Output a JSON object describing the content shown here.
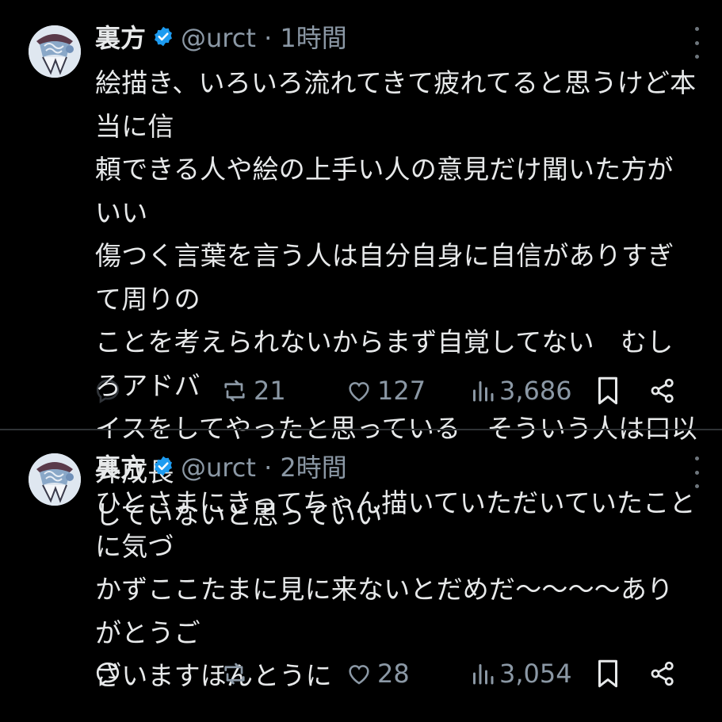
{
  "tweets": [
    {
      "name": "裏方",
      "handle": "@urct · 1時間",
      "text": "絵描き、いろいろ流れてきて疲れてると思うけど本当に信\n頼できる人や絵の上手い人の意見だけ聞いた方がいい\n傷つく言葉を言う人は自分自身に自信がありすぎて周りの\nことを考えられないからまず自覚してない　むしろアドバ\nイスをしてやったと思っている　そういう人は口以外成長\nしていないと思っていい",
      "reply_count": "",
      "retweet_count": "21",
      "like_count": "127",
      "view_count": "3,686"
    },
    {
      "name": "裏方",
      "handle": "@urct · 2時間",
      "text": "ひとさまにきってちゃん描いていただいていたことに気づ\nかずここたまに見に来ないとだめだ〜〜〜〜ありがとうご\nざいますほんとうに",
      "reply_count": "",
      "retweet_count": "",
      "like_count": "28",
      "view_count": "3,054"
    }
  ],
  "colors": {
    "background": "#000000",
    "text": "#e7e9ea",
    "secondary": "#8b98a5",
    "verified": "#1d9bf0",
    "divider": "#2f3336"
  },
  "icons": [
    "verified-badge-icon",
    "more-icon",
    "reply-icon",
    "retweet-icon",
    "like-icon",
    "views-icon",
    "bookmark-icon",
    "share-icon"
  ]
}
